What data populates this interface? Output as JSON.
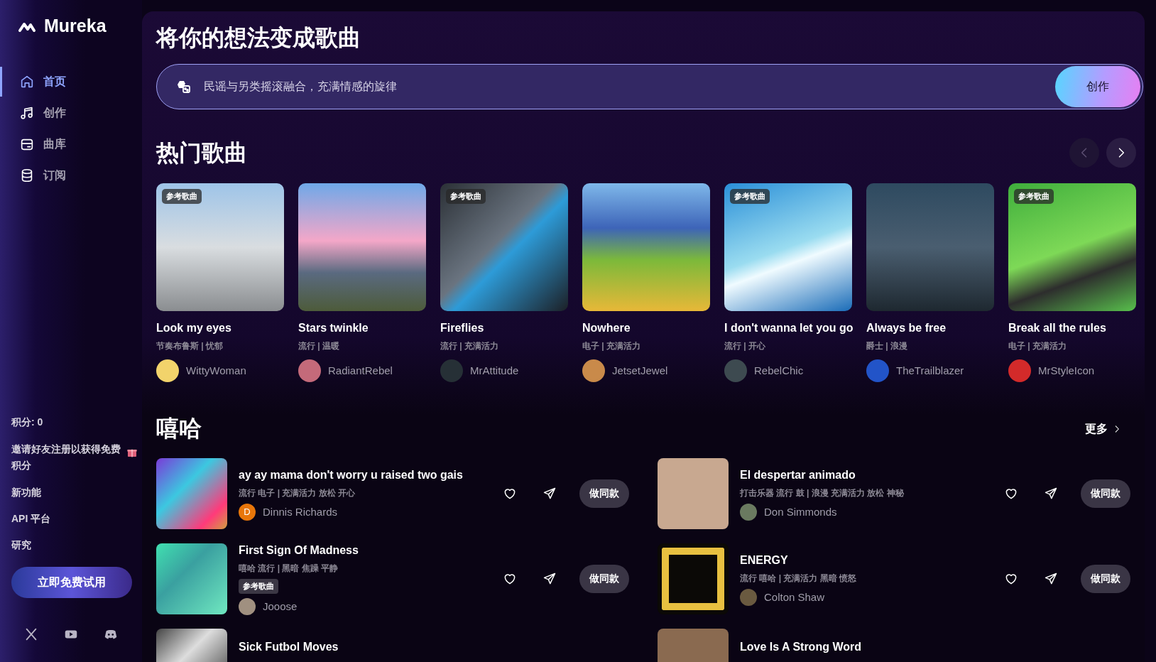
{
  "brand": {
    "name": "Mureka"
  },
  "nav": [
    {
      "label": "首页",
      "selected": true
    },
    {
      "label": "创作",
      "selected": false
    },
    {
      "label": "曲库",
      "selected": false
    },
    {
      "label": "订阅",
      "selected": false
    }
  ],
  "sidebar_footer": {
    "credits": "积分: 0",
    "invite": "邀请好友注册以获得免费积分",
    "links": [
      "新功能",
      "API 平台",
      "研究"
    ],
    "cta": "立即免费试用"
  },
  "hero": {
    "title": "将你的想法变成歌曲",
    "prompt": {
      "placeholder": "民谣与另类摇滚融合，充满情感的旋律"
    },
    "create_button": "创作"
  },
  "hot_songs": {
    "title": "热门歌曲",
    "prev_disabled": true,
    "next_disabled": false,
    "cards": [
      {
        "title": "Look my eyes",
        "tags": "节奏布鲁斯 | 忧郁",
        "author": "WittyWoman",
        "badge": "参考歌曲"
      },
      {
        "title": "Stars twinkle",
        "tags": "流行 | 温暖",
        "author": "RadiantRebel"
      },
      {
        "title": "Fireflies",
        "tags": "流行 | 充满活力",
        "author": "MrAttitude",
        "badge": "参考歌曲"
      },
      {
        "title": "Nowhere",
        "tags": "电子 | 充满活力",
        "author": "JetsetJewel"
      },
      {
        "title": "I don't wanna let you go",
        "tags": "流行 | 开心",
        "author": "RebelChic",
        "badge": "参考歌曲"
      },
      {
        "title": "Always be free",
        "tags": "爵士 | 浪漫",
        "author": "TheTrailblazer"
      },
      {
        "title": "Break all the rules",
        "tags": "电子 | 充满活力",
        "author": "MrStyleIcon",
        "badge": "参考歌曲"
      }
    ]
  },
  "hiphop": {
    "title": "嘻哈",
    "more": "更多",
    "songs": [
      {
        "title": "ay ay mama don't worry u raised two gais",
        "tags": "流行 电子 | 充满活力 放松 开心",
        "author": "Dinnis Richards",
        "avatar_letter": "D",
        "action": "做同款"
      },
      {
        "title": "El despertar animado",
        "tags": "打击乐器 流行 鼓 | 浪漫 充满活力 放松 神秘",
        "author": "Don Simmonds",
        "action": "做同款"
      },
      {
        "title": "First Sign Of Madness",
        "tags": "嘻哈 流行 | 黑暗 焦躁 平静",
        "badge": "参考歌曲",
        "author": "Jooose",
        "action": "做同款"
      },
      {
        "title": "ENERGY",
        "tags": "流行 嘻哈 | 充满活力 黑暗 愤怒",
        "author": "Colton Shaw",
        "action": "做同款"
      },
      {
        "title": "Sick Futbol Moves"
      },
      {
        "title": "Love Is A Strong Word"
      }
    ]
  }
}
